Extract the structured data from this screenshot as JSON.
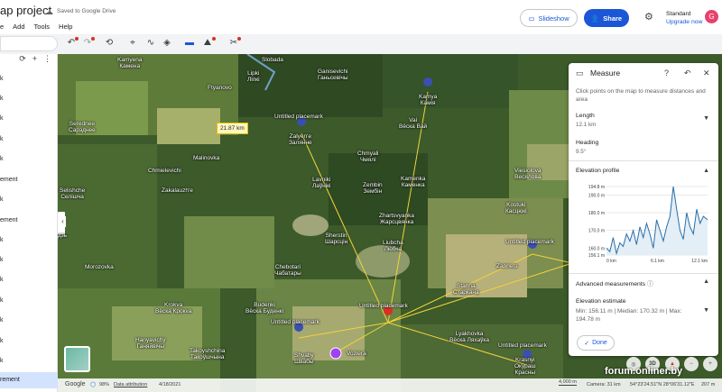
{
  "header": {
    "title": "ap project",
    "saved_status": "Saved to Google Drive",
    "menu": [
      "e",
      "Add",
      "Tools",
      "Help"
    ],
    "slideshow_label": "Slideshow",
    "share_label": "Share",
    "plan_name": "Standard",
    "upgrade_label": "Upgrade now",
    "avatar_letter": "G"
  },
  "sidebar": {
    "items": [
      "k",
      "k",
      "k",
      "k",
      "k",
      "ement",
      "k",
      "ement",
      "k",
      "k",
      "k",
      "k",
      "k",
      "k",
      "k",
      "rement"
    ]
  },
  "map": {
    "labels": {
      "slobada": "Slobada",
      "kamyena": "Kamyena\nКамена",
      "lipki": "Lipki\nЛіпкі",
      "ftyanovo": "Ftyanovo",
      "ganisevichi": "Ganisevichi\nГаньсевічы",
      "kamya": "Kamya\nКамія",
      "vai": "Vai\nВёска Вай",
      "serednee": "Serednee\nСарэднее",
      "zalyene": "Zalyen'e\nЗалянне",
      "placemark_top": "Untitled placemark",
      "chmyali": "Chmyali\nЧмялі",
      "malinovka": "Malinovka",
      "chmielevichi": "Chmielevichi",
      "lavniki": "Lavniki\nЛаўнікі",
      "zembin": "Zembin\nЗембін",
      "kamenka": "Kamenka\nКаменка",
      "viesiolova": "Viesiolova\nВесялова",
      "zakalauzhe": "Zakalauzh'e",
      "selishche": "Selishche\nСелішча",
      "kostuki": "Kostuki\nКасцюкі",
      "zhartsvyanka": "Zhartsvyanka\nЖарсцвянка",
      "sherstin": "Sherstin\nШарсцін",
      "liubcha": "Liubcha\nЛюбча",
      "placemark_right": "Untitled placemark",
      "zannets": "Zannets",
      "morozovka": "Morozovka",
      "chebotari": "Chebotari\nЧабатары",
      "stanna": "Stanna\nСтаркана",
      "krokva": "Krokva\nВёска Крокva",
      "budenki": "Budenki\nВёска Буденкі",
      "placemark_center": "Untitled placemark",
      "placemark_left": "Untitled placemark",
      "lyakhovka": "Lyakhovka\nВёска Ляхаўка",
      "hanyavichy": "Hanyavichy\nГаняйвічы",
      "takoyshchina": "Takoyshchina\nТакоўшчына",
      "shvaby": "Shvaby\nШвабы",
      "vozjera": "Voziera",
      "placemark_br": "Untitled placemark",
      "krasny": "Krasnyi\nОкураш\nКрасны",
      "pdt": "дзь"
    },
    "distance_tag": "21.87 km",
    "bottom": {
      "google": "Google",
      "pct": "98%",
      "attribution": "Data attribution",
      "date": "4/18/2021",
      "scale": "4,000 m",
      "camera": "Camera: 31 km",
      "coords": "54°23'24.51\"N 28°06'31.12\"E",
      "elev": "207 m"
    },
    "view_3d": "3D",
    "watermark": "forum.onliner.by"
  },
  "measure": {
    "title": "Measure",
    "instructions": "Click points on the map to measure distances and area",
    "length_label": "Length",
    "length_value": "12.1 km",
    "heading_label": "Heading",
    "heading_value": "9.5°",
    "elevation_label": "Elevation profile",
    "advanced_label": "Advanced measurements",
    "estimate_label": "Elevation estimate",
    "estimate_value": "Min: 156.11 m | Median: 170.32 m | Max: 194.78 m",
    "done_label": "Done"
  },
  "chart_data": {
    "type": "area",
    "title": "Elevation profile",
    "xlabel": "",
    "ylabel": "",
    "x_ticks": [
      "0 km",
      "6.1 km",
      "12.1 km"
    ],
    "y_ticks": [
      "194.8 m",
      "190.0 m",
      "180.0 m",
      "170.0 m",
      "160.0 m",
      "156.1 m"
    ],
    "ylim": [
      156.1,
      194.8
    ],
    "xlim": [
      0,
      12.1
    ],
    "x": [
      0,
      0.4,
      0.8,
      1.2,
      1.6,
      2.0,
      2.4,
      2.8,
      3.2,
      3.6,
      4.0,
      4.4,
      4.8,
      5.2,
      5.6,
      6.0,
      6.4,
      6.8,
      7.2,
      7.6,
      8.0,
      8.4,
      8.8,
      9.2,
      9.6,
      10.0,
      10.4,
      10.8,
      11.2,
      11.6,
      12.1
    ],
    "y": [
      160,
      158,
      166,
      157,
      163,
      161,
      168,
      164,
      170,
      162,
      172,
      166,
      174,
      168,
      160,
      176,
      170,
      164,
      172,
      178,
      194.8,
      182,
      170,
      165,
      180,
      172,
      168,
      182,
      174,
      178,
      176
    ]
  }
}
